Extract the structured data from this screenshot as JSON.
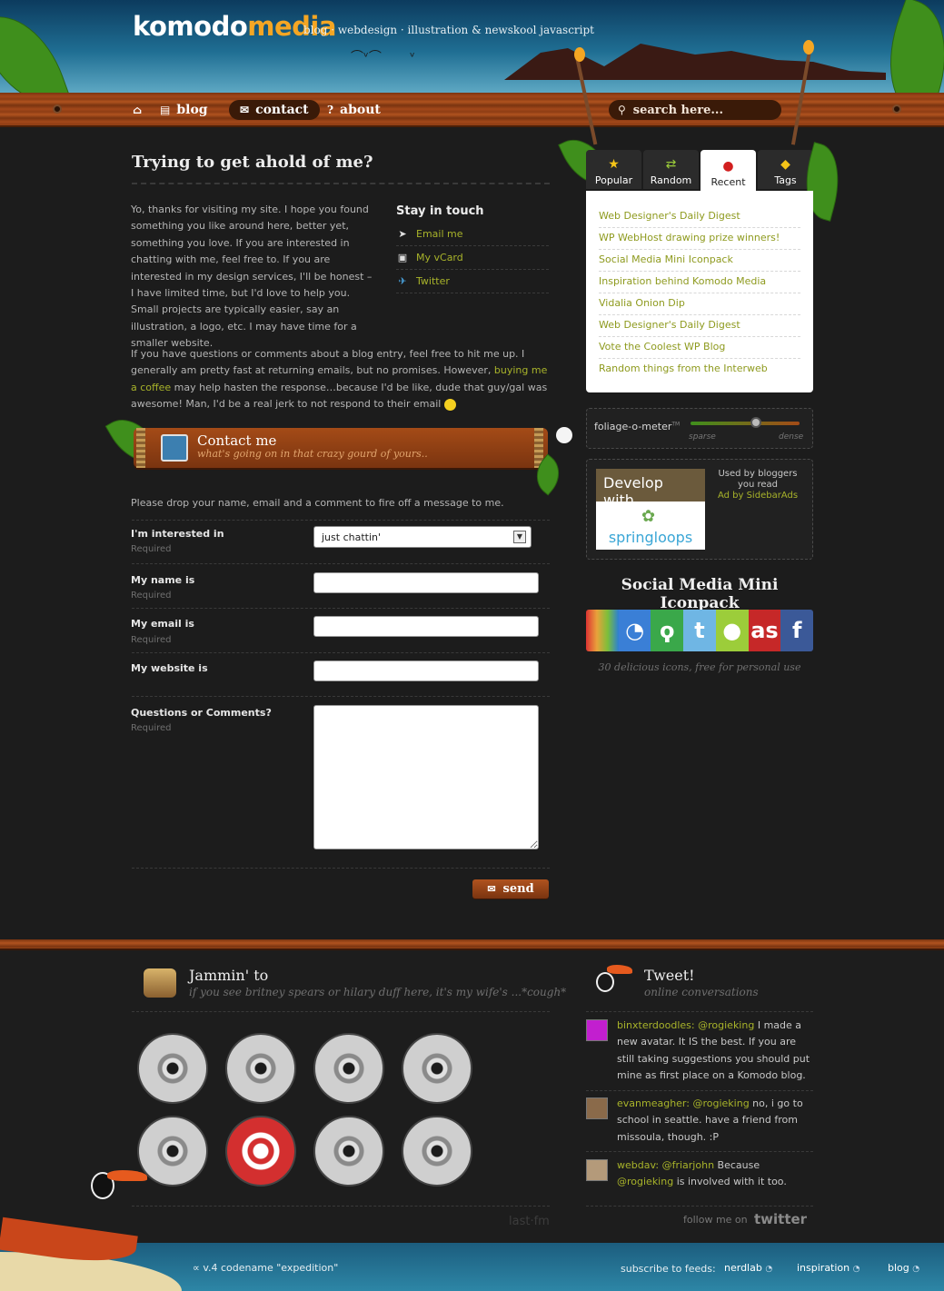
{
  "header": {
    "logo_a": "komodo",
    "logo_b": "media",
    "tagline": "blog · webdesign · illustration & newskool javascript"
  },
  "nav": {
    "items": [
      {
        "label": "blog",
        "icon": "book-icon"
      },
      {
        "label": "contact",
        "icon": "envelope-icon"
      },
      {
        "label": "about",
        "icon": "question-icon"
      }
    ],
    "home_icon": "home-icon",
    "search_placeholder": "search here..."
  },
  "main": {
    "title": "Trying to get ahold of me?",
    "intro_p1": "Yo, thanks for visiting my site. I hope you found something you like around here, better yet, something you love. If you are interested in chatting with me, feel free to. If you are interested in my design services, I'll be honest – I have limited time, but I'd love to help you. Small projects are typically easier, say an illustration, a logo, etc. I may have time for a smaller website.",
    "intro_p2_a": "If you have questions or comments about a blog entry, feel free to hit me up. I generally am pretty fast at returning emails, but no promises. However, ",
    "intro_p2_link": "buying me a coffee",
    "intro_p2_b": " may help hasten the response…because I'd be like, dude that guy/gal was awesome! Man, I'd be a real jerk to not respond to their email",
    "stay": {
      "title": "Stay in touch",
      "links": [
        {
          "label": "Email me",
          "icon": "paper-plane-icon"
        },
        {
          "label": "My vCard",
          "icon": "vcard-icon"
        },
        {
          "label": "Twitter",
          "icon": "bird-icon"
        }
      ]
    }
  },
  "contact": {
    "banner_title": "Contact me",
    "banner_subtitle": "what's going on in that crazy gourd of yours..",
    "intro": "Please drop your name, email and a comment to fire off a message to me.",
    "required": "Required",
    "fields": {
      "interest_label": "I'm interested in",
      "interest_value": "just chattin'",
      "name_label": "My name is",
      "email_label": "My email is",
      "website_label": "My website is",
      "comments_label": "Questions or Comments?"
    },
    "send_label": "send"
  },
  "sidebar": {
    "tabs": [
      {
        "label": "Popular",
        "icon": "star-icon"
      },
      {
        "label": "Random",
        "icon": "shuffle-icon"
      },
      {
        "label": "Recent",
        "icon": "alert-icon"
      },
      {
        "label": "Tags",
        "icon": "tag-icon"
      }
    ],
    "recent": [
      "Web Designer's Daily Digest",
      "WP WebHost drawing prize winners!",
      "Social Media Mini Iconpack",
      "Inspiration behind Komodo Media",
      "Vidalia Onion Dip",
      "Web Designer's Daily Digest",
      "Vote the Coolest WP Blog",
      "Random things from the Interweb"
    ],
    "foliage": {
      "label": "foliage-o-meter",
      "tm": "TM",
      "sparse": "sparse",
      "dense": "dense",
      "level": 0.6
    },
    "ad": {
      "headline": "Develop with",
      "brand": "springloops",
      "text": "Used by bloggers you read",
      "credit": "Ad by SidebarAds"
    },
    "promo": {
      "title": "Social Media Mini Iconpack",
      "caption": "30 delicious icons, free for personal use"
    }
  },
  "footer": {
    "music_title": "Jammin' to",
    "music_sub": "if you see britney spears  or hilary duff here, it's my wife's ...*cough*",
    "lastfm": "last·fm",
    "tweet_title": "Tweet!",
    "tweet_sub": "online conversations",
    "tweets": [
      {
        "user": "binxterdoodles:",
        "mention": "@rogieking",
        "text": " I made a new avatar. It IS the best. If you are still taking suggestions you should put mine as first place on a Komodo blog."
      },
      {
        "user": "evanmeagher:",
        "mention": "@rogieking",
        "text": " no, i go to school in seattle. have a friend from missoula, though. :P"
      },
      {
        "user": "webdav:",
        "mention": "@friarjohn",
        "text": " Because ",
        "mention2": "@rogieking",
        "text2": " is involved with it too."
      }
    ],
    "follow": "follow me on",
    "twitter_logo": "twitter",
    "version": "v.4 codename \"expedition\"",
    "subscribe": "subscribe to feeds:",
    "feeds": [
      "nerdlab",
      "inspiration",
      "blog"
    ]
  }
}
